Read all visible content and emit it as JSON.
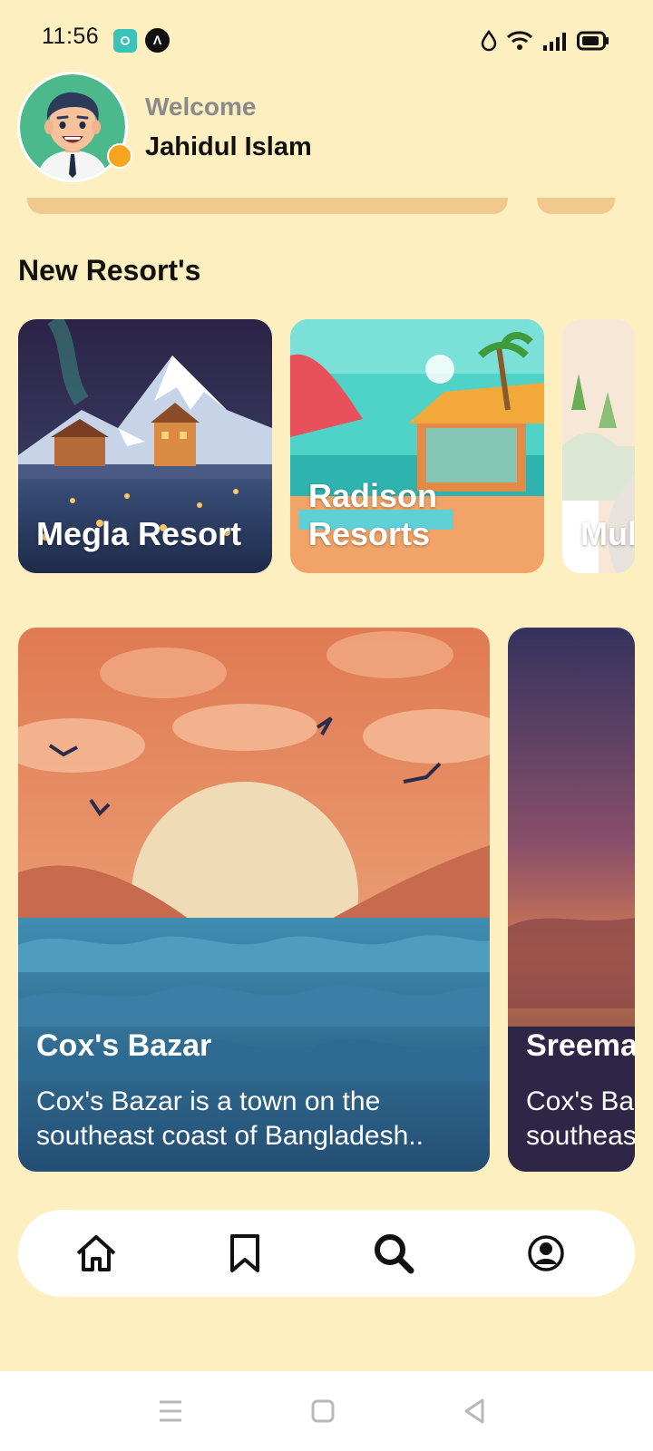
{
  "status_bar": {
    "time": "11:56",
    "icons": [
      "app-notification-icon",
      "a-notification-icon",
      "water-drop-icon",
      "wifi-icon",
      "signal-icon",
      "battery-icon"
    ]
  },
  "header": {
    "welcome_label": "Welcome",
    "user_name": "Jahidul Islam",
    "status_color": "#F7A41E"
  },
  "sections": {
    "new_resorts": {
      "title": "New Resort's",
      "items": [
        {
          "name": "Megla Resort"
        },
        {
          "name": "Radison Resorts"
        },
        {
          "name": "Mul"
        }
      ]
    }
  },
  "destinations": [
    {
      "title": "Cox's Bazar",
      "description": "Cox's Bazar is a town on the southeast coast of Bangladesh..",
      "desc_line1": "Cox's Bazar is a town on the",
      "desc_line2": "southeast coast of Bangladesh.."
    },
    {
      "title": "Sreema",
      "desc_line1": "Cox's Ba",
      "desc_line2": "southeas"
    }
  ],
  "bottom_nav": {
    "items": [
      "home-icon",
      "bookmark-icon",
      "search-icon",
      "profile-icon"
    ]
  },
  "system_nav": [
    "menu-icon",
    "home-square-icon",
    "back-icon"
  ],
  "colors": {
    "background": "#FDEFBF",
    "accent": "#F1C98F",
    "nav_background": "#FFFFFF"
  }
}
